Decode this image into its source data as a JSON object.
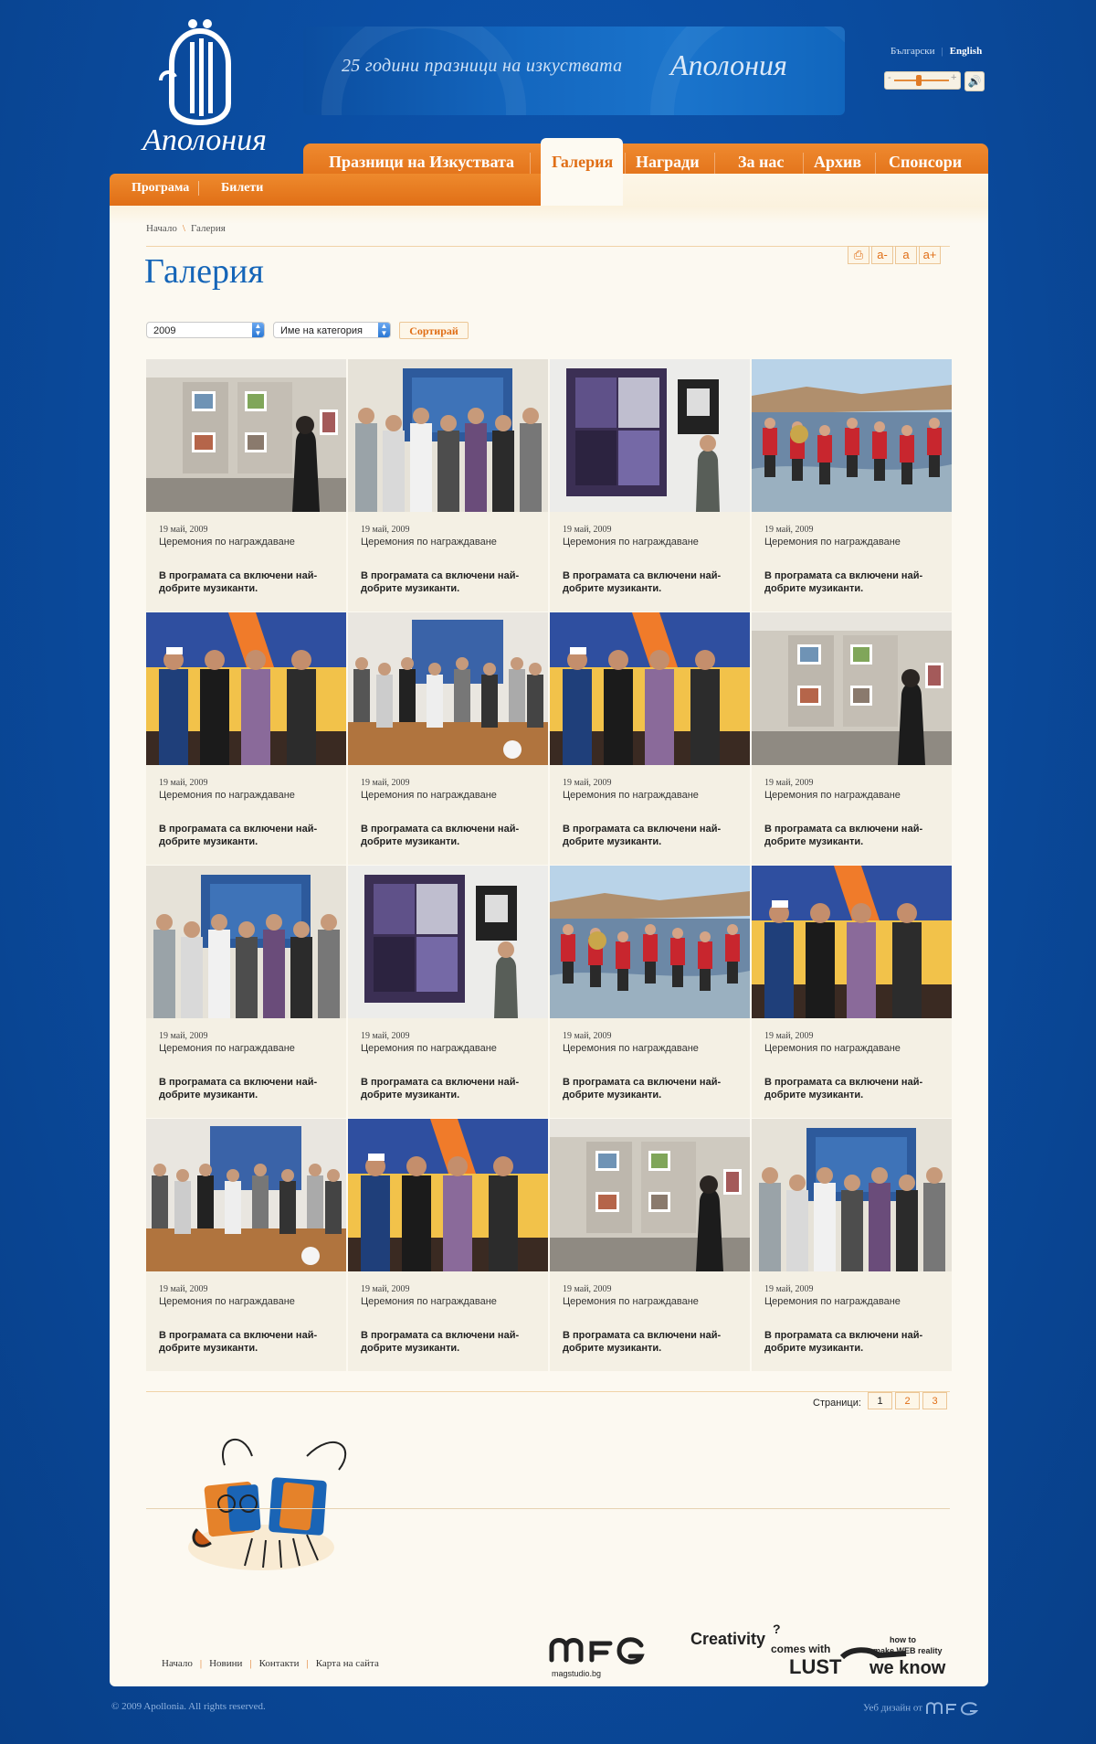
{
  "brand": {
    "logo_text": "Аполония",
    "banner_text": "25 години празници на изкуствата",
    "banner_script": "Аполония"
  },
  "languages": [
    {
      "label": "Български",
      "active": false
    },
    {
      "label": "English",
      "active": true
    }
  ],
  "volume": {
    "level": 0.45
  },
  "main_nav": [
    {
      "label": "Празници на Изкуствата"
    },
    {
      "label": "Галерия",
      "active": true
    },
    {
      "label": "Награди"
    },
    {
      "label": "За нас"
    },
    {
      "label": "Архив"
    },
    {
      "label": "Спонсори"
    }
  ],
  "sub_nav": [
    "Програма",
    "Билети"
  ],
  "breadcrumb": [
    "Начало",
    "Галерия"
  ],
  "tools": {
    "print": "⎙",
    "font_smaller": "a-",
    "font_normal": "a",
    "font_larger": "a+"
  },
  "page_title": "Галерия",
  "filters": {
    "year": "2009",
    "category": "Име на категория",
    "sort_label": "Сортирай"
  },
  "gallery": [
    {
      "date": "19 май, 2009",
      "category": "Церемония по награждаване",
      "desc": "В програмата са включени най-добрите музиканти.",
      "scene": "gallery-wall"
    },
    {
      "date": "19 май, 2009",
      "category": "Церемония по награждаване",
      "desc": "В програмата са включени най-добрите музиканти.",
      "scene": "crowd"
    },
    {
      "date": "19 май, 2009",
      "category": "Церемония по награждаване",
      "desc": "В програмата са включени най-добрите музиканти.",
      "scene": "quilt"
    },
    {
      "date": "19 май, 2009",
      "category": "Церемония по награждаване",
      "desc": "В програмата са включени най-добрите музиканти.",
      "scene": "beach"
    },
    {
      "date": "19 май, 2009",
      "category": "Церемония по награждаване",
      "desc": "В програмата са включени най-добрите музиканти.",
      "scene": "stage"
    },
    {
      "date": "19 май, 2009",
      "category": "Церемония по награждаване",
      "desc": "В програмата са включени най-добрите музиканти.",
      "scene": "room"
    },
    {
      "date": "19 май, 2009",
      "category": "Церемония по награждаване",
      "desc": "В програмата са включени най-добрите музиканти.",
      "scene": "stage"
    },
    {
      "date": "19 май, 2009",
      "category": "Церемония по награждаване",
      "desc": "В програмата са включени най-добрите музиканти.",
      "scene": "gallery-wall"
    },
    {
      "date": "19 май, 2009",
      "category": "Церемония по награждаване",
      "desc": "В програмата са включени най-добрите музиканти.",
      "scene": "crowd"
    },
    {
      "date": "19 май, 2009",
      "category": "Церемония по награждаване",
      "desc": "В програмата са включени най-добрите музиканти.",
      "scene": "quilt"
    },
    {
      "date": "19 май, 2009",
      "category": "Церемония по награждаване",
      "desc": "В програмата са включени най-добрите музиканти.",
      "scene": "beach"
    },
    {
      "date": "19 май, 2009",
      "category": "Церемония по награждаване",
      "desc": "В програмата са включени най-добрите музиканти.",
      "scene": "stage"
    },
    {
      "date": "19 май, 2009",
      "category": "Церемония по награждаване",
      "desc": "В програмата са включени най-добрите музиканти.",
      "scene": "room"
    },
    {
      "date": "19 май, 2009",
      "category": "Церемония по награждаване",
      "desc": "В програмата са включени най-добрите музиканти.",
      "scene": "stage"
    },
    {
      "date": "19 май, 2009",
      "category": "Церемония по награждаване",
      "desc": "В програмата са включени най-добрите музиканти.",
      "scene": "gallery-wall"
    },
    {
      "date": "19 май, 2009",
      "category": "Церемония по награждаване",
      "desc": "В програмата са включени най-добрите музиканти.",
      "scene": "crowd"
    }
  ],
  "pagination": {
    "label": "Страници:",
    "pages": [
      "1",
      "2",
      "3"
    ],
    "current": "1"
  },
  "footer_links": [
    "Начало",
    "Новини",
    "Контакти",
    "Карта на сайта"
  ],
  "credits": {
    "mag_site": "magstudio.bg",
    "slogan": [
      "Creativity",
      "comes with",
      "LUST",
      "how to",
      "make WEB reality",
      "we know"
    ]
  },
  "copyright": "© 2009 Apollonia. All rights reserved.",
  "webdesign_label": "Уеб дизайн  от",
  "colors": {
    "background": "#0a4fa6",
    "orange": "#e06e16",
    "title_blue": "#1565b8",
    "content_bg": "#fcf9f1"
  }
}
